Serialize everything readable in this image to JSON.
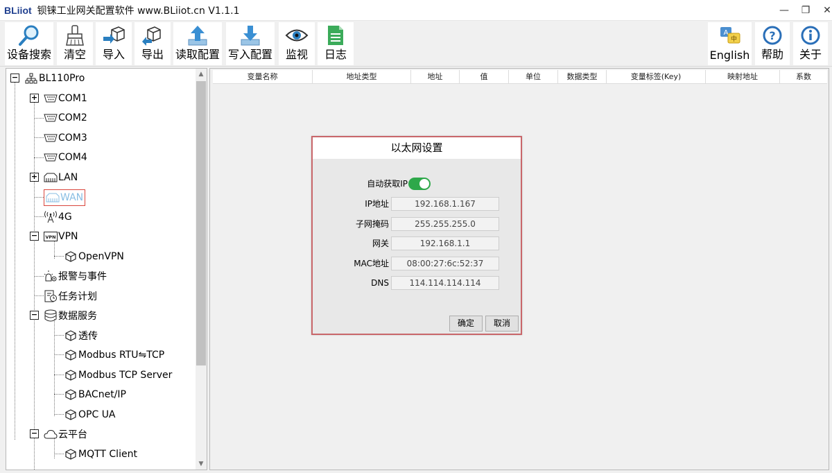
{
  "window": {
    "logo": "BLiiot",
    "title": "钡铼工业网关配置软件 www.BLiiot.cn V1.1.1",
    "min": "—",
    "max": "❐",
    "close": "✕"
  },
  "toolbar": {
    "search": "设备搜索",
    "clear": "清空",
    "import": "导入",
    "export": "导出",
    "read": "读取配置",
    "write": "写入配置",
    "monitor": "监视",
    "log": "日志",
    "english": "English",
    "help": "帮助",
    "about": "关于"
  },
  "tree": {
    "root": "BL110Pro",
    "com1": "COM1",
    "com2": "COM2",
    "com3": "COM3",
    "com4": "COM4",
    "lan": "LAN",
    "wan": "WAN",
    "g4": "4G",
    "vpn": "VPN",
    "openvpn": "OpenVPN",
    "alarm": "报警与事件",
    "task": "任务计划",
    "data": "数据服务",
    "passthrough": "透传",
    "modbus_rtu_tcp": "Modbus RTU⇋TCP",
    "modbus_tcp_server": "Modbus TCP Server",
    "bacnet": "BACnet/IP",
    "opcua": "OPC UA",
    "cloud": "云平台",
    "mqtt": "MQTT Client"
  },
  "grid": {
    "columns": [
      "变量名称",
      "地址类型",
      "地址",
      "值",
      "单位",
      "数据类型",
      "变量标签(Key)",
      "映射地址",
      "系数"
    ]
  },
  "dialog": {
    "title": "以太网设置",
    "auto_ip_label": "自动获取IP",
    "auto_ip_on": true,
    "ip_label": "IP地址",
    "ip": "192.168.1.167",
    "mask_label": "子网掩码",
    "mask": "255.255.255.0",
    "gw_label": "网关",
    "gw": "192.168.1.1",
    "mac_label": "MAC地址",
    "mac": "08:00:27:6c:52:37",
    "dns_label": "DNS",
    "dns": "114.114.114.114",
    "ok": "确定",
    "cancel": "取消"
  },
  "colors": {
    "toggle_on": "#2ea84a",
    "dialog_border": "#c9666a",
    "wan_highlight": "#88bde3",
    "logo": "#1f3f8f"
  }
}
